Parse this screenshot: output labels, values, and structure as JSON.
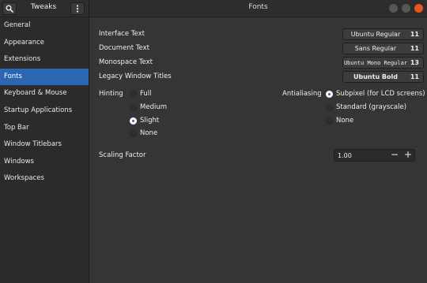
{
  "header": {
    "app_title": "Tweaks",
    "window_title": "Fonts",
    "search_icon": "search-icon",
    "menu_icon": "vertical-dots-icon"
  },
  "sidebar": {
    "items": [
      {
        "label": "General"
      },
      {
        "label": "Appearance"
      },
      {
        "label": "Extensions"
      },
      {
        "label": "Fonts"
      },
      {
        "label": "Keyboard & Mouse"
      },
      {
        "label": "Startup Applications"
      },
      {
        "label": "Top Bar"
      },
      {
        "label": "Window Titlebars"
      },
      {
        "label": "Windows"
      },
      {
        "label": "Workspaces"
      }
    ],
    "active": "Fonts",
    "accent_color": "#2a66b2"
  },
  "fonts": {
    "interface": {
      "label": "Interface Text",
      "font": "Ubuntu Regular",
      "size": "11"
    },
    "document": {
      "label": "Document Text",
      "font": "Sans Regular",
      "size": "11"
    },
    "monospace": {
      "label": "Monospace Text",
      "font": "Ubuntu Mono Regular",
      "size": "13"
    },
    "legacy": {
      "label": "Legacy Window Titles",
      "font": "Ubuntu Bold",
      "size": "11"
    }
  },
  "hinting": {
    "label": "Hinting",
    "options": [
      "Full",
      "Medium",
      "Slight",
      "None"
    ],
    "selected": "Slight"
  },
  "antialiasing": {
    "label": "Antialiasing",
    "options": [
      "Subpixel (for LCD screens)",
      "Standard (grayscale)",
      "None"
    ],
    "selected": "Subpixel (for LCD screens)"
  },
  "scaling": {
    "label": "Scaling Factor",
    "value": "1.00",
    "minus": "−",
    "plus": "+"
  },
  "colors": {
    "close_button": "#e95420",
    "background": "#353535",
    "sidebar": "#2b2b2b"
  }
}
